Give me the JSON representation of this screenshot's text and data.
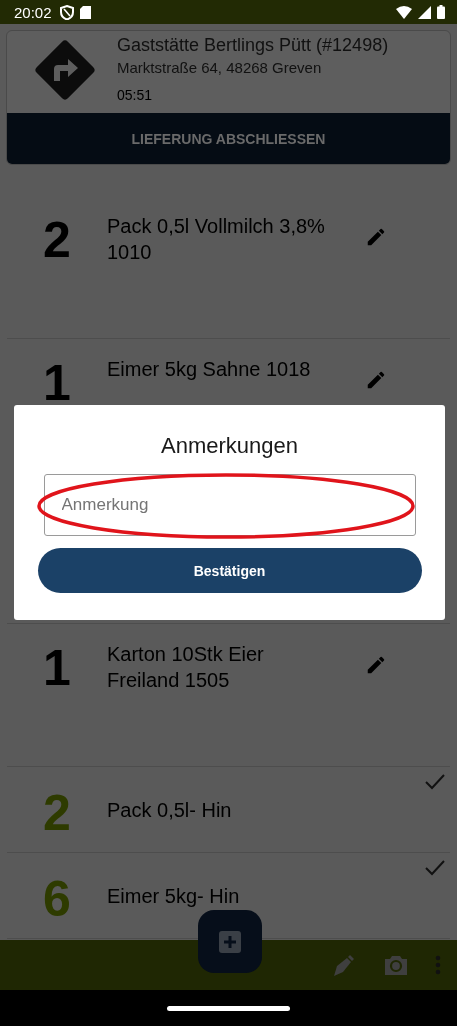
{
  "status_bar": {
    "time": "20:02"
  },
  "stop": {
    "name": "Gaststätte Bertlings Pütt (#12498)",
    "address": "Marktstraße 64, 48268 Greven",
    "time": "05:51",
    "action": "LIEFERUNG ABSCHLIESSEN"
  },
  "items": [
    {
      "quantity": "2",
      "name": "Pack 0,5l Vollmilch 3,8% 1010",
      "done": false
    },
    {
      "quantity": "1",
      "name": "Eimer 5kg Sahne 1018",
      "done": false
    },
    {
      "quantity": "1",
      "name": "Karton 10Stk Eier Freiland 1505",
      "done": false
    },
    {
      "quantity": "2",
      "name": "Pack 0,5l- Hin",
      "done": true
    },
    {
      "quantity": "6",
      "name": "Eimer 5kg- Hin",
      "done": true
    }
  ],
  "dialog": {
    "title": "Anmerkungen",
    "placeholder": "Anmerkung",
    "confirm": "Bestätigen",
    "highlighted": true
  }
}
